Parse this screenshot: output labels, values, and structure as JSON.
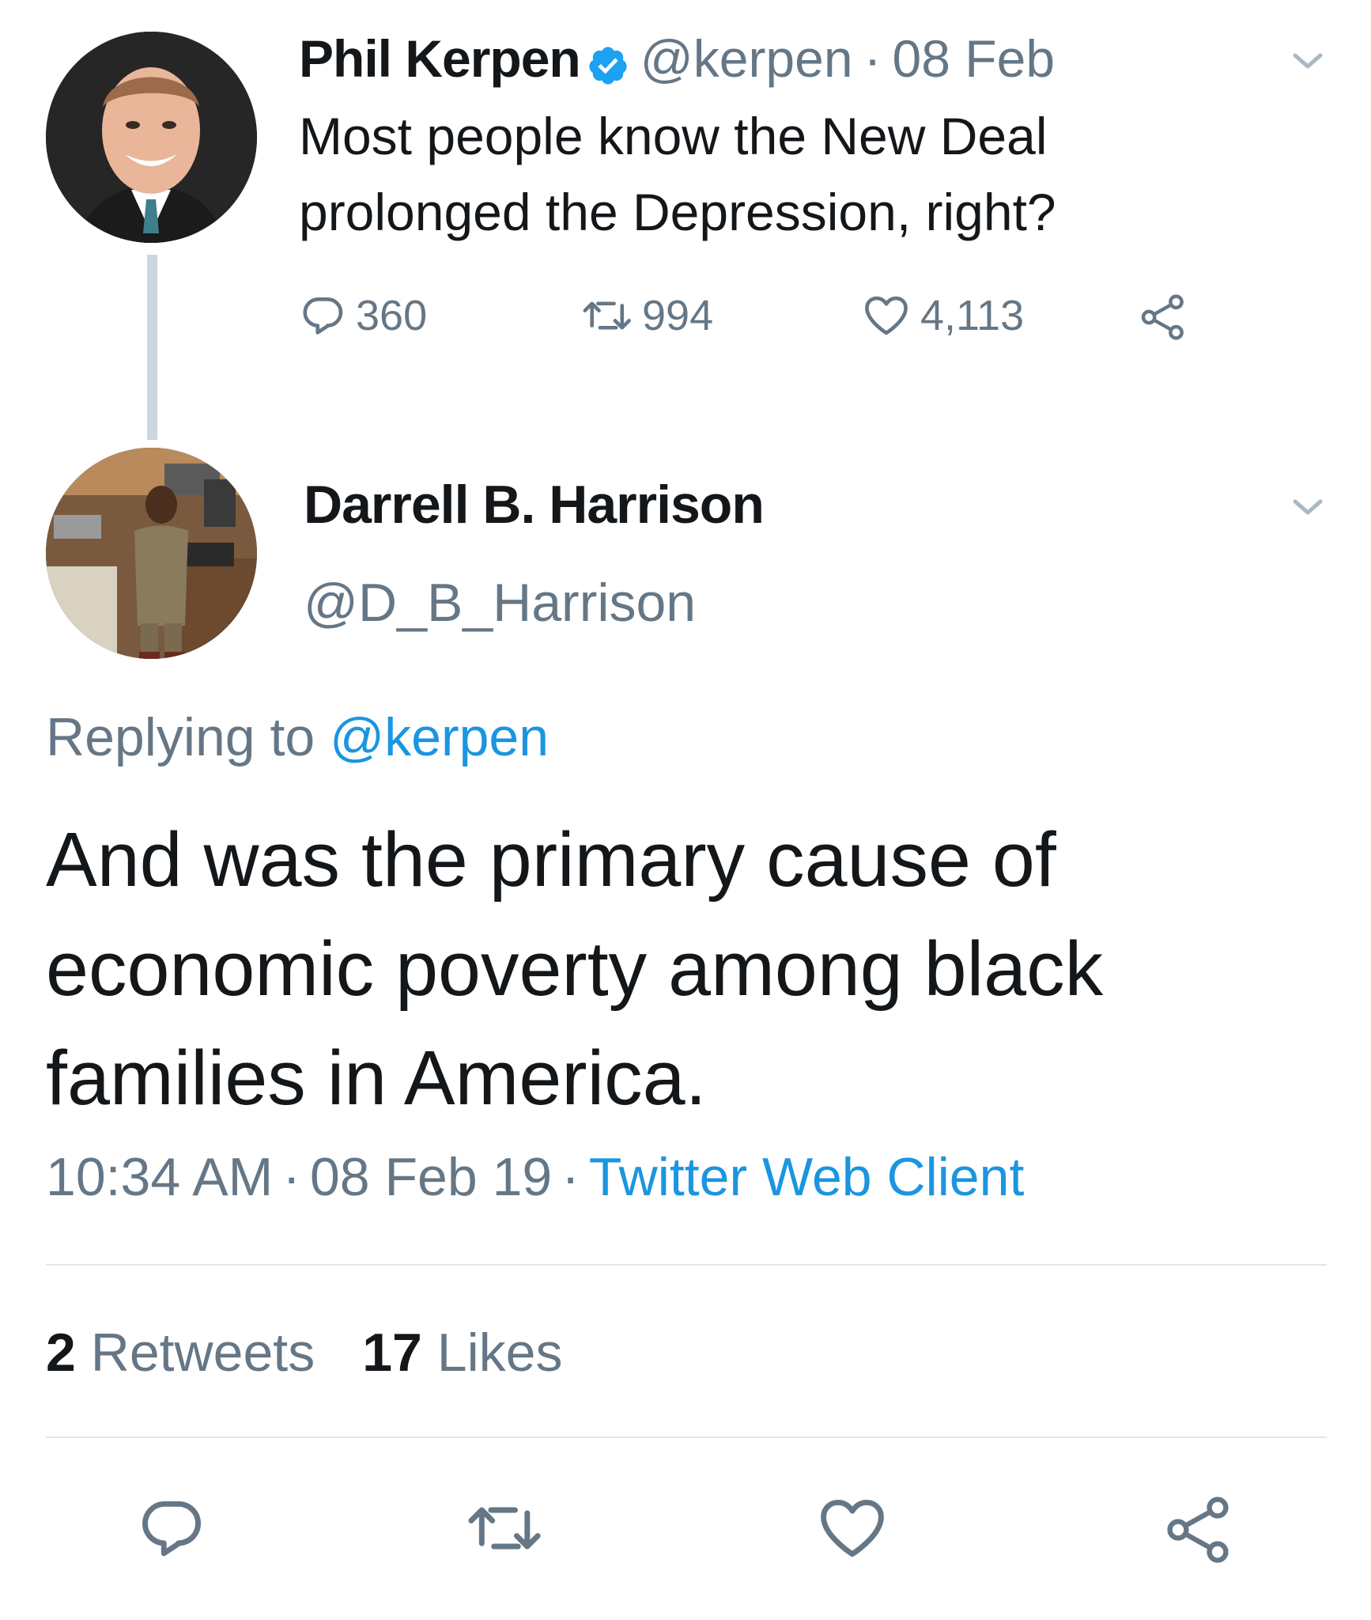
{
  "parent_tweet": {
    "name": "Phil Kerpen",
    "handle": "@kerpen",
    "separator": "·",
    "time": "08 Feb",
    "text": "Most people know the New Deal prolonged the Depression, right?",
    "replies": "360",
    "retweets": "994",
    "likes": "4,113",
    "verified": true
  },
  "main_tweet": {
    "name": "Darrell B. Harrison",
    "handle": "@D_B_Harrison",
    "replying_prefix": "Replying to",
    "replying_handle": "@kerpen",
    "text": "And was the primary cause of economic poverty among black families in America.",
    "time": "10:34 AM",
    "separator": "·",
    "date": "08 Feb 19",
    "client": "Twitter Web Client",
    "retweet_count": "2",
    "retweet_label": "Retweets",
    "like_count": "17",
    "like_label": "Likes"
  },
  "colors": {
    "text": "#14171a",
    "secondary": "#657786",
    "link": "#1b95e0",
    "verified": "#1da1f2",
    "divider": "#e1e8ed",
    "thread_line": "#ccd6dd"
  },
  "icons": {
    "reply": "reply-icon",
    "retweet": "retweet-icon",
    "like": "heart-icon",
    "share": "share-icon",
    "caret": "chevron-down-icon",
    "verified": "verified-badge-icon"
  }
}
